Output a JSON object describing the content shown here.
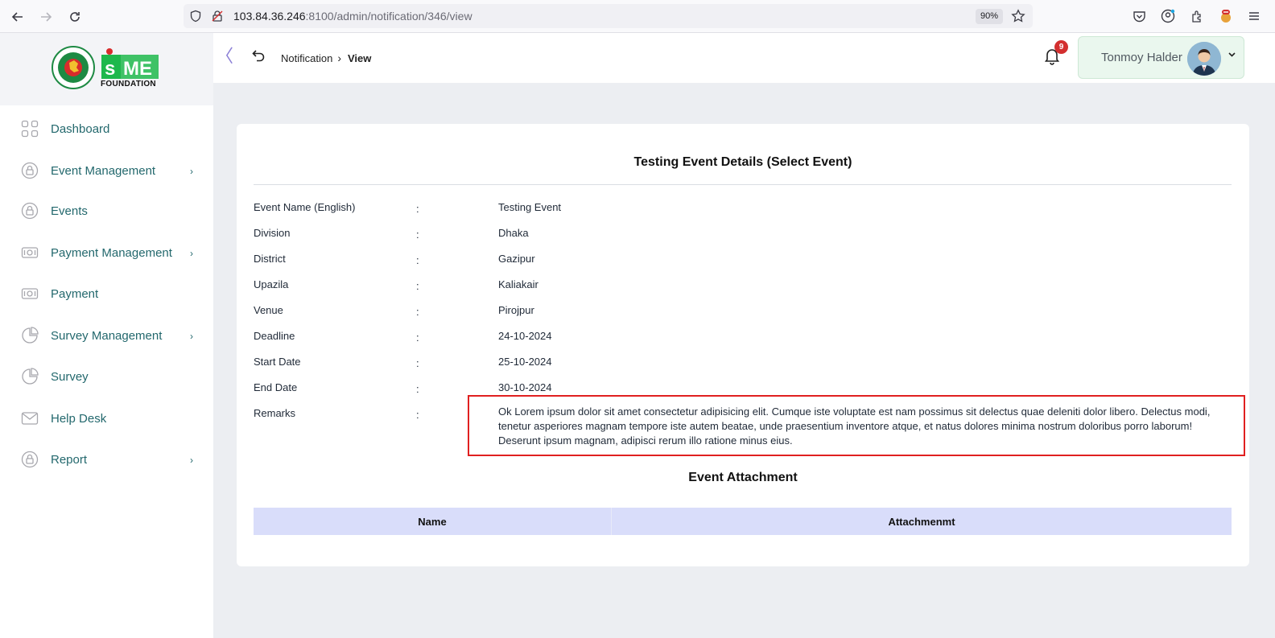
{
  "browser": {
    "url_host": "103.84.36.246",
    "url_rest": ":8100/admin/notification/346/view",
    "zoom": "90%"
  },
  "sidebar": {
    "logo_text": "FOUNDATION",
    "items": [
      {
        "label": "Dashboard",
        "icon": "grid-icon",
        "has_submenu": false
      },
      {
        "label": "Event Management",
        "icon": "lock-circle-icon",
        "has_submenu": true
      },
      {
        "label": "Events",
        "icon": "lock-circle-icon",
        "has_submenu": false
      },
      {
        "label": "Payment Management",
        "icon": "banknote-icon",
        "has_submenu": true
      },
      {
        "label": "Payment",
        "icon": "banknote-icon",
        "has_submenu": false
      },
      {
        "label": "Survey Management",
        "icon": "pie-chart-icon",
        "has_submenu": true
      },
      {
        "label": "Survey",
        "icon": "pie-chart-icon",
        "has_submenu": false
      },
      {
        "label": "Help Desk",
        "icon": "mail-icon",
        "has_submenu": false
      },
      {
        "label": "Report",
        "icon": "lock-circle-icon",
        "has_submenu": true
      }
    ]
  },
  "header": {
    "breadcrumb_parent": "Notification",
    "breadcrumb_current": "View",
    "notification_count": "9",
    "user_name": "Tonmoy Halder"
  },
  "details": {
    "title": "Testing Event Details (Select Event)",
    "rows": [
      {
        "label": "Event Name (English)",
        "value": "Testing Event"
      },
      {
        "label": "Division",
        "value": "Dhaka"
      },
      {
        "label": "District",
        "value": "Gazipur"
      },
      {
        "label": "Upazila",
        "value": "Kaliakair"
      },
      {
        "label": "Venue",
        "value": "Pirojpur"
      },
      {
        "label": "Deadline",
        "value": "24-10-2024"
      },
      {
        "label": "Start Date",
        "value": "25-10-2024"
      },
      {
        "label": "End Date",
        "value": "30-10-2024"
      }
    ],
    "remarks_label": "Remarks",
    "remarks_value": "Ok Lorem ipsum dolor sit amet consectetur adipisicing elit. Cumque iste voluptate est nam possimus sit delectus quae deleniti dolor libero. Delectus modi, tenetur asperiores magnam tempore iste autem beatae, unde praesentium inventore atque, et natus dolores minima nostrum doloribus porro laborum! Deserunt ipsum magnam, adipisci rerum illo ratione minus eius.",
    "separator": ":"
  },
  "attachments": {
    "title": "Event Attachment",
    "columns": [
      "Name",
      "Attachmenmt"
    ]
  },
  "colors": {
    "nav_text": "#23686d",
    "table_header": "#d9ddfa",
    "highlight_border": "#e02020",
    "user_chip": "#eaf7ee"
  }
}
